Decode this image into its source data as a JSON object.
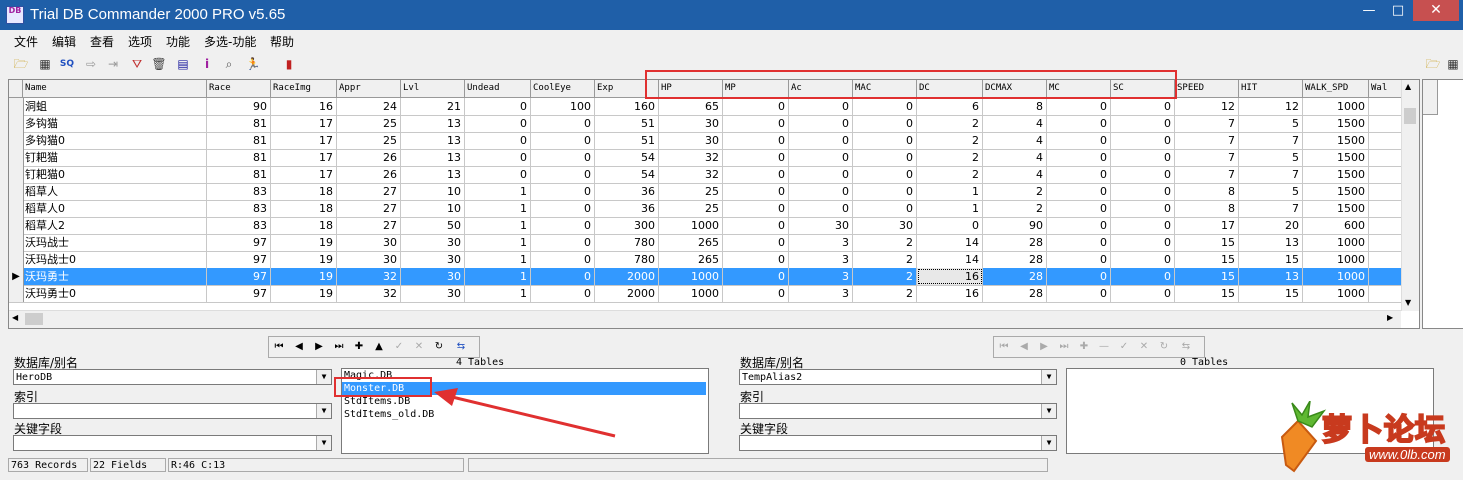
{
  "window": {
    "title": "Trial DB Commander 2000 PRO v5.65",
    "min_glyph": "—",
    "max_glyph": "□",
    "close_glyph": "✕"
  },
  "menu": [
    "文件",
    "编辑",
    "查看",
    "选项",
    "功能",
    "多选-功能",
    "帮助"
  ],
  "grid": {
    "columns": [
      "Name",
      "Race",
      "RaceImg",
      "Appr",
      "Lvl",
      "Undead",
      "CoolEye",
      "Exp",
      "HP",
      "MP",
      "Ac",
      "MAC",
      "DC",
      "DCMAX",
      "MC",
      "SC",
      "SPEED",
      "HIT",
      "WALK_SPD",
      "Wal"
    ],
    "rows": [
      [
        "洞蛆",
        "90",
        "16",
        "24",
        "21",
        "0",
        "100",
        "160",
        "65",
        "0",
        "0",
        "0",
        "6",
        "8",
        "0",
        "0",
        "12",
        "12",
        "1000"
      ],
      [
        "多钩猫",
        "81",
        "17",
        "25",
        "13",
        "0",
        "0",
        "51",
        "30",
        "0",
        "0",
        "0",
        "2",
        "4",
        "0",
        "0",
        "7",
        "5",
        "1500"
      ],
      [
        "多钩猫0",
        "81",
        "17",
        "25",
        "13",
        "0",
        "0",
        "51",
        "30",
        "0",
        "0",
        "0",
        "2",
        "4",
        "0",
        "0",
        "7",
        "7",
        "1500"
      ],
      [
        "钉耙猫",
        "81",
        "17",
        "26",
        "13",
        "0",
        "0",
        "54",
        "32",
        "0",
        "0",
        "0",
        "2",
        "4",
        "0",
        "0",
        "7",
        "5",
        "1500"
      ],
      [
        "钉耙猫0",
        "81",
        "17",
        "26",
        "13",
        "0",
        "0",
        "54",
        "32",
        "0",
        "0",
        "0",
        "2",
        "4",
        "0",
        "0",
        "7",
        "7",
        "1500"
      ],
      [
        "稻草人",
        "83",
        "18",
        "27",
        "10",
        "1",
        "0",
        "36",
        "25",
        "0",
        "0",
        "0",
        "1",
        "2",
        "0",
        "0",
        "8",
        "5",
        "1500"
      ],
      [
        "稻草人0",
        "83",
        "18",
        "27",
        "10",
        "1",
        "0",
        "36",
        "25",
        "0",
        "0",
        "0",
        "1",
        "2",
        "0",
        "0",
        "8",
        "7",
        "1500"
      ],
      [
        "稻草人2",
        "83",
        "18",
        "27",
        "50",
        "1",
        "0",
        "300",
        "1000",
        "0",
        "30",
        "30",
        "0",
        "90",
        "0",
        "0",
        "17",
        "20",
        "600"
      ],
      [
        "沃玛战士",
        "97",
        "19",
        "30",
        "30",
        "1",
        "0",
        "780",
        "265",
        "0",
        "3",
        "2",
        "14",
        "28",
        "0",
        "0",
        "15",
        "13",
        "1000"
      ],
      [
        "沃玛战士0",
        "97",
        "19",
        "30",
        "30",
        "1",
        "0",
        "780",
        "265",
        "0",
        "3",
        "2",
        "14",
        "28",
        "0",
        "0",
        "15",
        "15",
        "1000"
      ],
      [
        "沃玛勇士",
        "97",
        "19",
        "32",
        "30",
        "1",
        "0",
        "2000",
        "1000",
        "0",
        "3",
        "2",
        "16",
        "28",
        "0",
        "0",
        "15",
        "13",
        "1000"
      ],
      [
        "沃玛勇士0",
        "97",
        "19",
        "32",
        "30",
        "1",
        "0",
        "2000",
        "1000",
        "0",
        "3",
        "2",
        "16",
        "28",
        "0",
        "0",
        "15",
        "15",
        "1000"
      ]
    ],
    "selected_row": 10,
    "selected_indicator": "▶"
  },
  "left_panel": {
    "table_count": "4 Tables",
    "db_label": "数据库/别名",
    "db_value": "HeroDB",
    "index_label": "索引",
    "index_value": "",
    "key_label": "关键字段",
    "key_value": "",
    "tables": [
      "Magic.DB",
      "Monster.DB",
      "StdItems.DB",
      "StdItems_old.DB"
    ],
    "selected_table": 1
  },
  "right_panel": {
    "table_count": "0 Tables",
    "db_label": "数据库/别名",
    "db_value": "TempAlias2",
    "index_label": "索引",
    "index_value": "",
    "key_label": "关键字段",
    "key_value": ""
  },
  "status": {
    "records": "763 Records",
    "fields": "22 Fields",
    "position": "R:46 C:13"
  },
  "logo": {
    "text": "萝卜论坛",
    "url": "www.0lb.com"
  },
  "colors": {
    "selection": "#3399ff",
    "annotation": "#e03030",
    "titlebar": "#1f5fa8"
  }
}
